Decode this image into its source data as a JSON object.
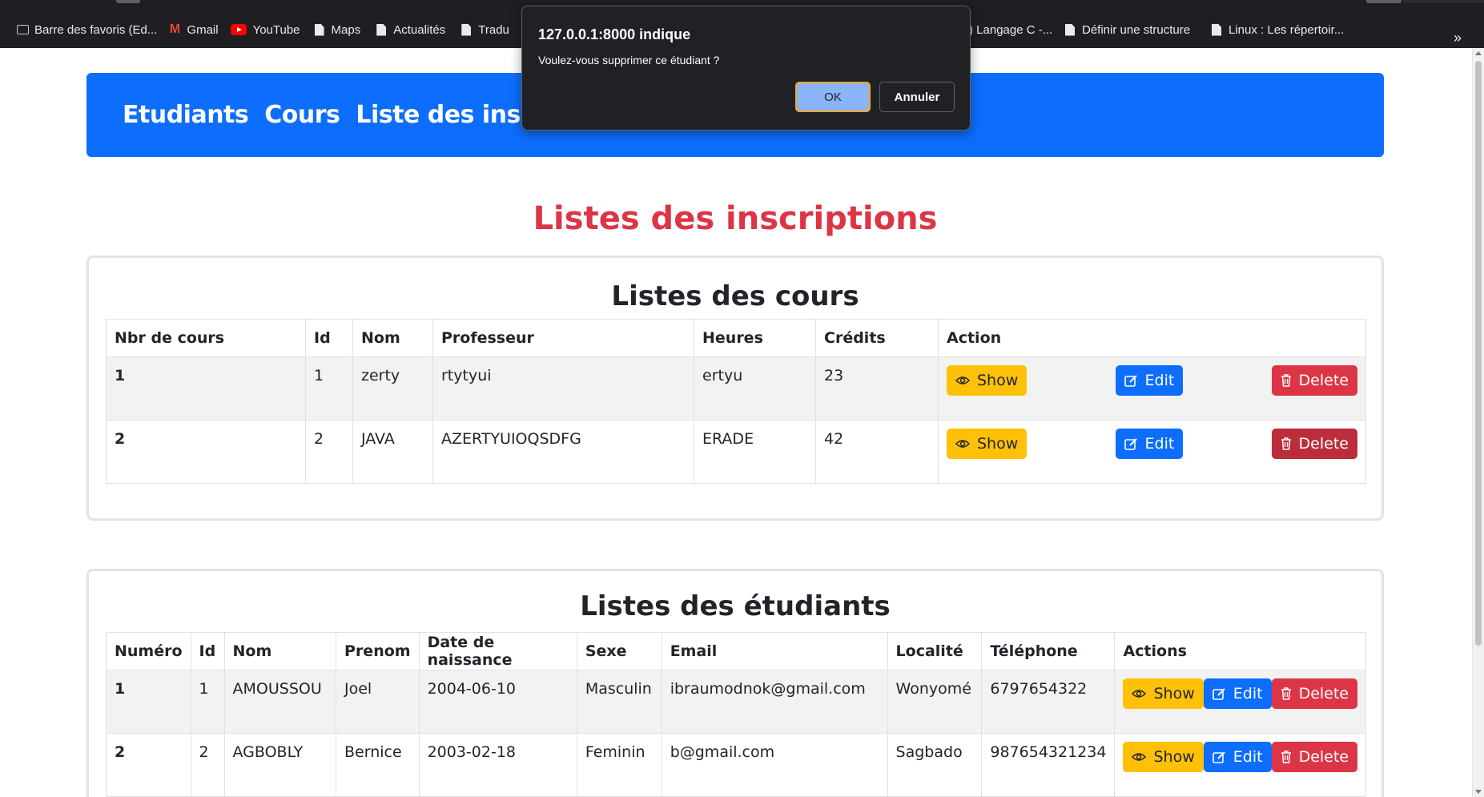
{
  "bookmarks": [
    {
      "label": "Barre des favoris (Ed...",
      "icon": "folder-icon"
    },
    {
      "label": "Gmail",
      "icon": "gmail-icon"
    },
    {
      "label": "YouTube",
      "icon": "youtube-icon"
    },
    {
      "label": "Maps",
      "icon": "file-icon"
    },
    {
      "label": "Actualités",
      "icon": "file-icon"
    },
    {
      "label": "Tradu",
      "icon": "file-icon"
    },
    {
      "label": ") Langage C -...",
      "icon": "file-icon"
    },
    {
      "label": "Définir une structure",
      "icon": "file-icon"
    },
    {
      "label": "Linux : Les répertoir...",
      "icon": "file-icon"
    }
  ],
  "bookmarks_more": "»",
  "navbar": {
    "links": [
      "Etudiants",
      "Cours",
      "Liste des inscriptions"
    ]
  },
  "page_title": "Listes des inscriptions",
  "courses": {
    "title": "Listes des cours",
    "headers": [
      "Nbr de cours",
      "Id",
      "Nom",
      "Professeur",
      "Heures",
      "Crédits",
      "Action"
    ],
    "rows": [
      {
        "num": "1",
        "id": "1",
        "nom": "zerty",
        "prof": "rtytyui",
        "heures": "ertyu",
        "credits": "23"
      },
      {
        "num": "2",
        "id": "2",
        "nom": "JAVA",
        "prof": "AZERTYUIOQSDFG",
        "heures": "ERADE",
        "credits": "42"
      }
    ]
  },
  "students": {
    "title": "Listes des étudiants",
    "headers": [
      "Numéro",
      "Id",
      "Nom",
      "Prenom",
      "Date de naissance",
      "Sexe",
      "Email",
      "Localité",
      "Téléphone",
      "Actions"
    ],
    "rows": [
      {
        "num": "1",
        "id": "1",
        "nom": "AMOUSSOU",
        "prenom": "Joel",
        "dob": "2004-06-10",
        "sexe": "Masculin",
        "email": "ibraumodnok@gmail.com",
        "loc": "Wonyomé",
        "tel": "6797654322"
      },
      {
        "num": "2",
        "id": "2",
        "nom": "AGBOBLY",
        "prenom": "Bernice",
        "dob": "2003-02-18",
        "sexe": "Feminin",
        "email": "b@gmail.com",
        "loc": "Sagbado",
        "tel": "987654321234"
      }
    ]
  },
  "buttons": {
    "show": "Show",
    "edit": "Edit",
    "delete": "Delete"
  },
  "dialog": {
    "title": "127.0.0.1:8000 indique",
    "message": "Voulez-vous supprimer ce étudiant ?",
    "ok": "OK",
    "cancel": "Annuler"
  },
  "colors": {
    "navbar": "#0d6efd",
    "title": "#dc3545",
    "warning": "#ffc107",
    "primary": "#0d6efd",
    "danger": "#dc3545"
  }
}
